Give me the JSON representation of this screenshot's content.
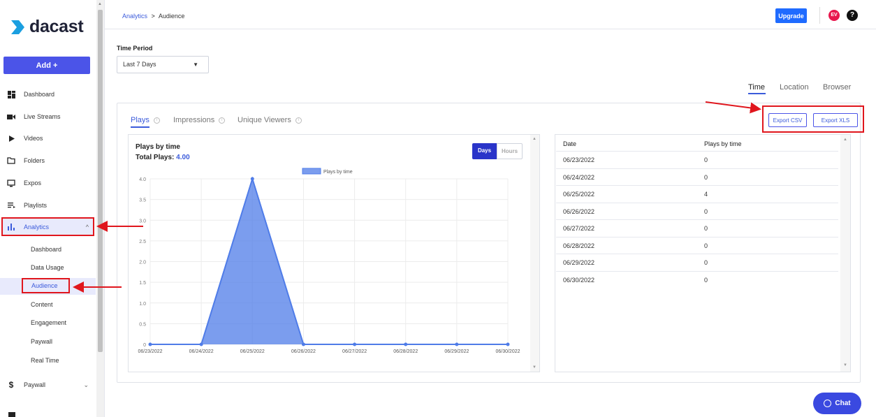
{
  "sidebar": {
    "logo": "dacast",
    "add_label": "Add +",
    "items": [
      {
        "label": "Dashboard",
        "icon": "dashboard-icon"
      },
      {
        "label": "Live Streams",
        "icon": "camera-icon"
      },
      {
        "label": "Videos",
        "icon": "play-icon"
      },
      {
        "label": "Folders",
        "icon": "folder-icon"
      },
      {
        "label": "Expos",
        "icon": "monitor-icon"
      },
      {
        "label": "Playlists",
        "icon": "playlist-icon"
      },
      {
        "label": "Analytics",
        "icon": "bar-chart-icon",
        "caret": "^"
      },
      {
        "label": "Paywall",
        "icon": "dollar-icon",
        "caret": "⌄"
      }
    ],
    "analytics_sub": [
      "Dashboard",
      "Data Usage",
      "Audience",
      "Content",
      "Engagement",
      "Paywall",
      "Real Time"
    ],
    "active_sub": "Audience"
  },
  "topbar": {
    "breadcrumb_parent": "Analytics",
    "breadcrumb_sep": ">",
    "breadcrumb_current": "Audience",
    "upgrade_label": "Upgrade",
    "avatar_initials": "EV",
    "help_label": "?"
  },
  "filters": {
    "time_period_label": "Time Period",
    "time_period_value": "Last 7 Days"
  },
  "view_tabs": [
    "Time",
    "Location",
    "Browser"
  ],
  "metric_tabs": [
    "Plays",
    "Impressions",
    "Unique Viewers"
  ],
  "export": {
    "csv": "Export CSV",
    "xls": "Export XLS"
  },
  "chart_panel": {
    "title": "Plays by time",
    "total_label": "Total Plays:",
    "total_value": "4.00",
    "toggle_days": "Days",
    "toggle_hours": "Hours"
  },
  "chart_data": {
    "type": "area",
    "x": [
      "06/23/2022",
      "06/24/2022",
      "06/25/2022",
      "06/26/2022",
      "06/27/2022",
      "06/28/2022",
      "06/29/2022",
      "06/30/2022"
    ],
    "series": [
      {
        "name": "Plays by time",
        "values": [
          0,
          0,
          4,
          0,
          0,
          0,
          0,
          0
        ]
      }
    ],
    "yticks": [
      "4.0",
      "3.5",
      "3.0",
      "2.5",
      "2.0",
      "1.5",
      "1.0",
      "0.5",
      "0"
    ],
    "ylim": [
      0,
      4
    ],
    "grid": true,
    "legend": "top-center",
    "color": "#4f7ce8"
  },
  "table": {
    "headers": [
      "Date",
      "Plays by time"
    ],
    "rows": [
      [
        "06/23/2022",
        "0"
      ],
      [
        "06/24/2022",
        "0"
      ],
      [
        "06/25/2022",
        "4"
      ],
      [
        "06/26/2022",
        "0"
      ],
      [
        "06/27/2022",
        "0"
      ],
      [
        "06/28/2022",
        "0"
      ],
      [
        "06/29/2022",
        "0"
      ],
      [
        "06/30/2022",
        "0"
      ]
    ]
  },
  "chat_label": "Chat",
  "colors": {
    "accent": "#3b5bdb",
    "annotation": "#e0161d",
    "upgrade": "#1f6bff"
  }
}
